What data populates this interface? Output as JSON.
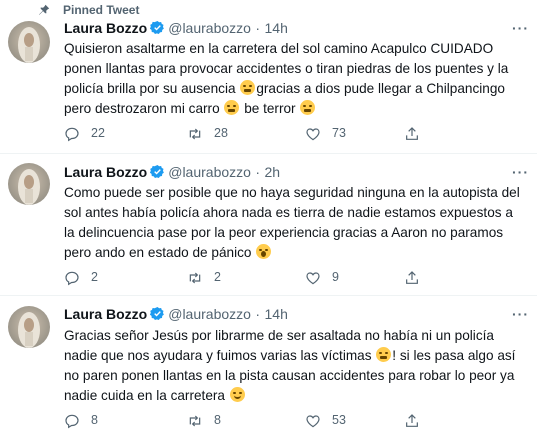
{
  "pinned_label": "Pinned Tweet",
  "tweets": [
    {
      "name": "Laura Bozzo",
      "handle": "@laurabozzo",
      "dot": "·",
      "time": "14h",
      "more": "···",
      "text": {
        "l1": "Quisieron asaltarme en la carretera del sol camino Acapulco CUIDADO",
        "l2": "ponen llantas para provocar accidentes o tiran piedras de los puentes y la",
        "l3a": "policía brilla por su ausencia ",
        "l3b": "gracias a dios pude llegar a Chilpancingo",
        "l4a": "pero destrozaron mi carro ",
        "l4b": " be terror "
      },
      "replies": "22",
      "retweets": "28",
      "likes": "73"
    },
    {
      "name": "Laura Bozzo",
      "handle": "@laurabozzo",
      "dot": "·",
      "time": "2h",
      "more": "···",
      "text": {
        "l1": "Como puede ser posible que no haya seguridad ninguna en la autopista del",
        "l2": "sol antes había policía ahora nada es tierra de nadie estamos expuestos a",
        "l3": "la delincuencia pase por la peor experiencia gracias a Aaron no paramos",
        "l4": "pero ando en estado de pánico "
      },
      "replies": "2",
      "retweets": "2",
      "likes": "9"
    },
    {
      "name": "Laura Bozzo",
      "handle": "@laurabozzo",
      "dot": "·",
      "time": "14h",
      "more": "···",
      "text": {
        "l1": "Gracias señor Jesús por librarme de ser asaltada no había ni un policía",
        "l2a": "nadie que nos ayudara y fuimos varias las víctimas ",
        "l2b": "! si les pasa algo así",
        "l3": "no paren ponen llantas en la pista causan accidentes para robar lo peor ya",
        "l4": "nadie cuida en la carretera "
      },
      "replies": "8",
      "retweets": "8",
      "likes": "53"
    }
  ],
  "icons": {
    "pin": "pin-icon",
    "verified": "verified-badge-icon",
    "reply": "reply-icon",
    "retweet": "retweet-icon",
    "like": "heart-icon",
    "share": "share-icon"
  },
  "colors": {
    "text": "#0f1419",
    "secondary": "#536471",
    "verified": "#1d9bf0",
    "divider": "#eff3f4"
  }
}
